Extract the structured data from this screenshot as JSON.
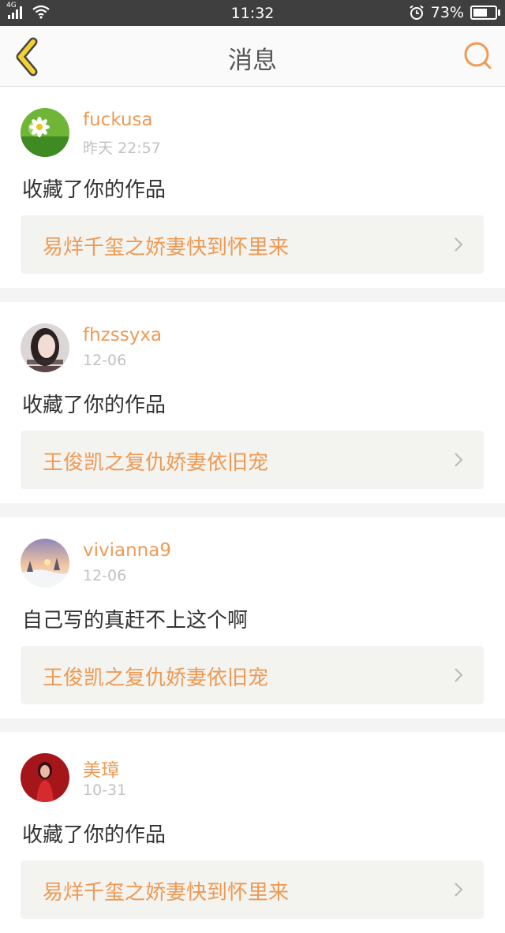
{
  "status_bar": {
    "network": "4G",
    "time": "11:32",
    "battery": "73%",
    "battery_level": 0.73
  },
  "header": {
    "title": "消息",
    "back_icon": "chevron-left-icon",
    "search_icon": "search-icon"
  },
  "colors": {
    "accent": "#ee9a55",
    "back_icon": "#f5d130",
    "link_bg": "#f3f3ef",
    "separator": "#f4f4f4"
  },
  "messages": [
    {
      "username": "fuckusa",
      "time": "昨天 22:57",
      "text": "收藏了你的作品",
      "work": "易烊千玺之娇妻快到怀里来"
    },
    {
      "username": "fhzssyxa",
      "time": "12-06",
      "text": "收藏了你的作品",
      "work": "王俊凯之复仇娇妻依旧宠"
    },
    {
      "username": "vivianna9",
      "time": "12-06",
      "text": "自己写的真赶不上这个啊",
      "work": "王俊凯之复仇娇妻依旧宠"
    },
    {
      "username": "美璋",
      "time": "10-31",
      "text": "收藏了你的作品",
      "work": "易烊千玺之娇妻快到怀里来"
    }
  ]
}
